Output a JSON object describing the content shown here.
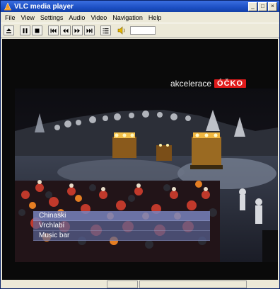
{
  "window": {
    "title": "VLC media player"
  },
  "menu": [
    "File",
    "View",
    "Settings",
    "Audio",
    "Video",
    "Navigation",
    "Help"
  ],
  "toolbar": {
    "buttons": [
      "eject-icon",
      "pause-icon",
      "stop-icon",
      "skip-back-icon",
      "rewind-icon",
      "fast-forward-icon",
      "skip-forward-icon",
      "playlist-icon"
    ],
    "volume_level": 0.0
  },
  "video": {
    "watermark_text": "akcelerace",
    "logo_text": "ÓČKO",
    "playlist": [
      "Chinaski",
      "Vrchlabí",
      "Music bar"
    ],
    "selected_index": 0
  },
  "colors": {
    "titlebar": "#1c4fc4",
    "logo": "#e01b1b"
  }
}
